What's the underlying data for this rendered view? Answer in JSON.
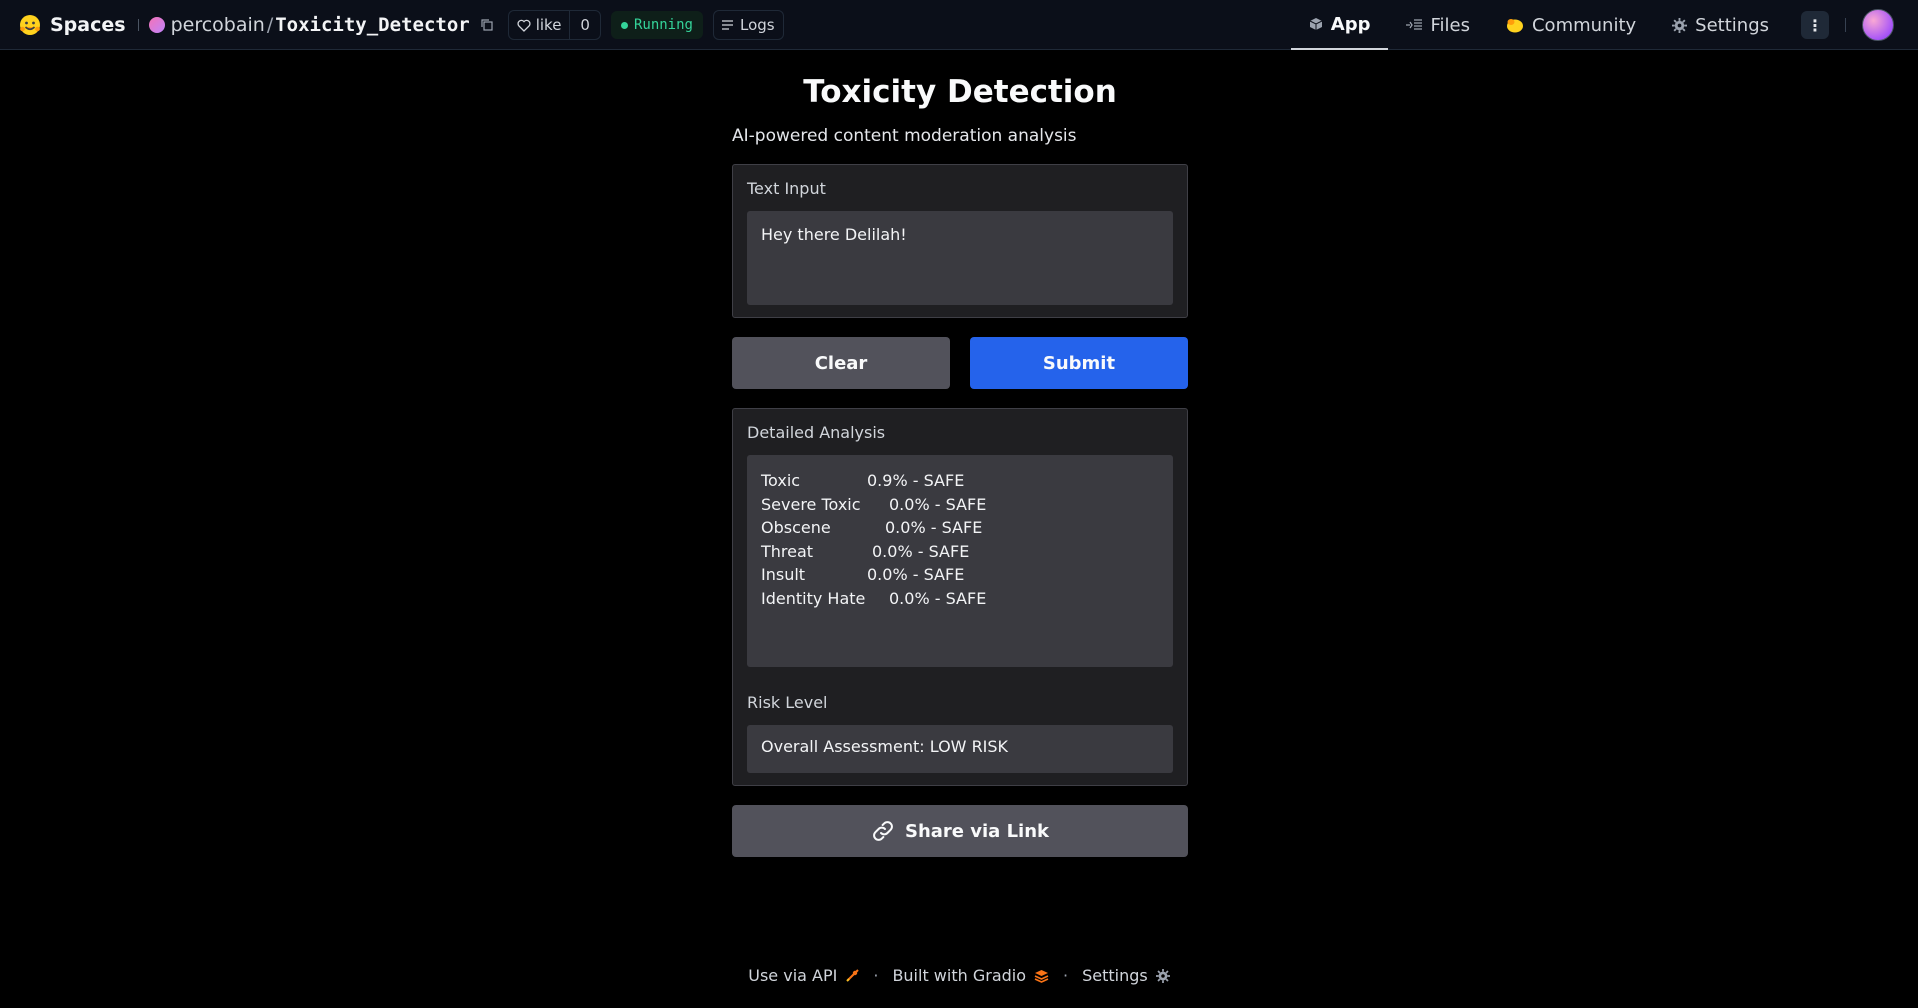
{
  "header": {
    "brand": "Spaces",
    "owner": "percobain",
    "separator": "/",
    "repo": "Toxicity_Detector",
    "like_label": "like",
    "like_count": "0",
    "status": "Running",
    "logs_label": "Logs",
    "nav": [
      {
        "label": "App",
        "icon": "cube-icon",
        "active": true
      },
      {
        "label": "Files",
        "icon": "files-icon",
        "active": false
      },
      {
        "label": "Community",
        "icon": "community-icon",
        "active": false
      },
      {
        "label": "Settings",
        "icon": "gear-icon",
        "active": false
      }
    ],
    "more_icon": "⋮"
  },
  "main": {
    "title": "Toxicity Detection",
    "subtitle": "AI-powered content moderation analysis",
    "text_input": {
      "label": "Text Input",
      "value": "Hey there Delilah!"
    },
    "buttons": {
      "clear": "Clear",
      "submit": "Submit"
    },
    "analysis": {
      "label": "Detailed Analysis",
      "rows": [
        {
          "category": "Toxic",
          "result": "0.9% - SAFE"
        },
        {
          "category": "Severe Toxic",
          "result": "0.0% - SAFE"
        },
        {
          "category": "Obscene",
          "result": "0.0% - SAFE"
        },
        {
          "category": "Threat",
          "result": "0.0% - SAFE"
        },
        {
          "category": "Insult",
          "result": "0.0% - SAFE"
        },
        {
          "category": "Identity Hate",
          "result": "0.0% - SAFE"
        }
      ]
    },
    "risk": {
      "label": "Risk Level",
      "value": "Overall Assessment: LOW RISK"
    },
    "share_label": "Share via Link"
  },
  "footer": {
    "api": "Use via API",
    "built": "Built with Gradio",
    "settings": "Settings",
    "sep": "·"
  },
  "colors": {
    "background": "#000000",
    "header_bg": "#0b0f19",
    "submit": "#2563eb",
    "secondary_button": "#52525b",
    "running": "#34d399"
  }
}
